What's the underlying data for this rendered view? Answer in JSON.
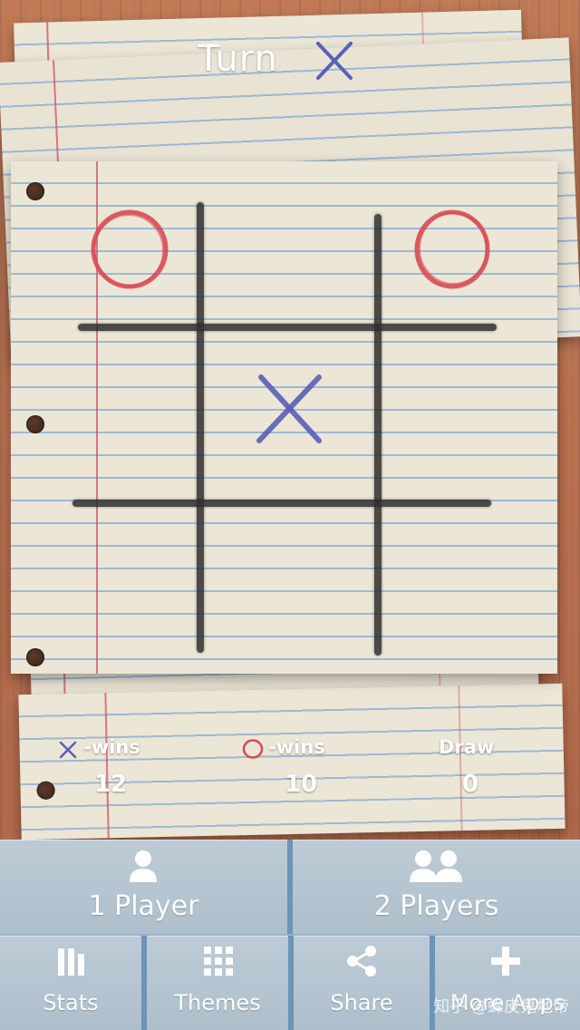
{
  "header": {
    "turn_label": "Turn",
    "current_turn": "X"
  },
  "board": {
    "cells": [
      "O",
      "",
      "O",
      "",
      "X",
      "",
      "",
      "",
      ""
    ]
  },
  "scores": {
    "x": {
      "label": "-wins",
      "value": "12"
    },
    "o": {
      "label": "-wins",
      "value": "10"
    },
    "draw": {
      "label": "Draw",
      "value": "0"
    }
  },
  "menu": {
    "one_player": "1 Player",
    "two_players": "2 Players",
    "stats": "Stats",
    "themes": "Themes",
    "share": "Share",
    "more": "More Apps"
  },
  "watermark": "知乎 @蜂皮鬼地帝",
  "colors": {
    "x_mark": "#5a5fb8",
    "o_mark": "#d84a55",
    "menu_bg": "#b7c7d3",
    "divider": "#6e93b8"
  }
}
